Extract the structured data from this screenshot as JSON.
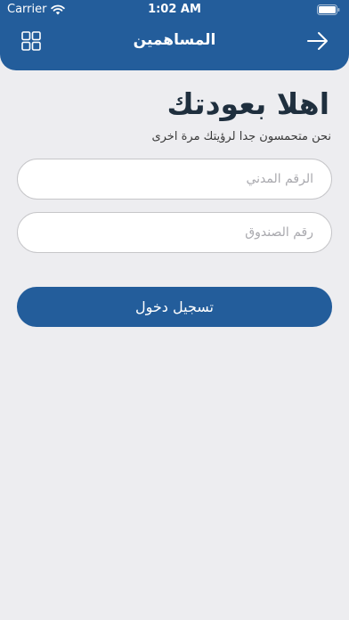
{
  "status_bar": {
    "carrier": "Carrier",
    "time": "1:02 AM",
    "icons": [
      "wifi-icon",
      "battery-icon"
    ]
  },
  "header": {
    "title": "المساهمين",
    "left_icon": "grid-icon",
    "right_icon": "arrow-right-icon",
    "background": "#235d9b"
  },
  "main": {
    "welcome_title": "اهلا بعودتك",
    "subtitle": "نحن متحمسون جدا لرؤيتك مرة اخرى",
    "civil_id": {
      "placeholder": "الرقم المدني",
      "value": ""
    },
    "box_number": {
      "placeholder": "رقم الصندوق",
      "value": ""
    },
    "login_label": "تسجيل دخول"
  },
  "colors": {
    "accent": "#235d9b",
    "background": "#ededf0",
    "title_text": "#1f2f3e"
  }
}
